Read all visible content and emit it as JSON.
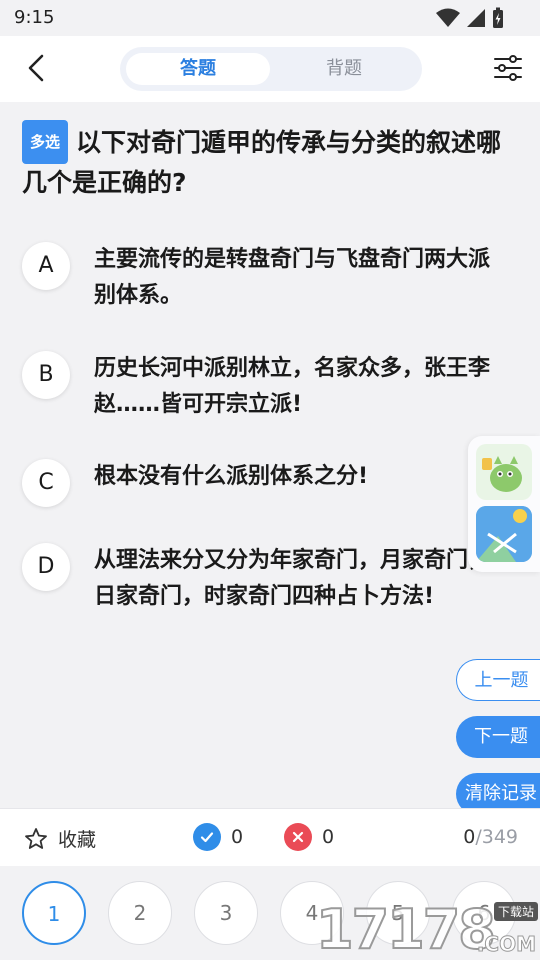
{
  "status_bar": {
    "time": "9:15"
  },
  "header": {
    "tabs": [
      {
        "label": "答题",
        "active": true
      },
      {
        "label": "背题",
        "active": false
      }
    ]
  },
  "question": {
    "type_badge": "多选",
    "text": "以下对奇门遁甲的传承与分类的叙述哪几个是正确的?"
  },
  "options": [
    {
      "letter": "A",
      "text": "主要流传的是转盘奇门与飞盘奇门两大派别体系。"
    },
    {
      "letter": "B",
      "text": "历史长河中派别林立，名家众多，张王李赵……皆可开宗立派!"
    },
    {
      "letter": "C",
      "text": "根本没有什么派别体系之分!"
    },
    {
      "letter": "D",
      "text": "从理法来分又分为年家奇门，月家奇门，日家奇门，时家奇门四种占卜方法!"
    }
  ],
  "nav": {
    "prev": "上一题",
    "next": "下一题",
    "clear": "清除记录"
  },
  "bottom_bar": {
    "favorite_label": "收藏",
    "correct_count": "0",
    "wrong_count": "0",
    "progress_current": "0",
    "progress_total": "/349"
  },
  "number_strip": [
    "1",
    "2",
    "3",
    "4",
    "5",
    "6"
  ],
  "watermark": {
    "number": "17178",
    "tag": "下载站",
    "suffix": ".COM"
  },
  "colors": {
    "accent": "#2f8de8",
    "wrong": "#ea4b56",
    "background": "#f2f2f4"
  }
}
